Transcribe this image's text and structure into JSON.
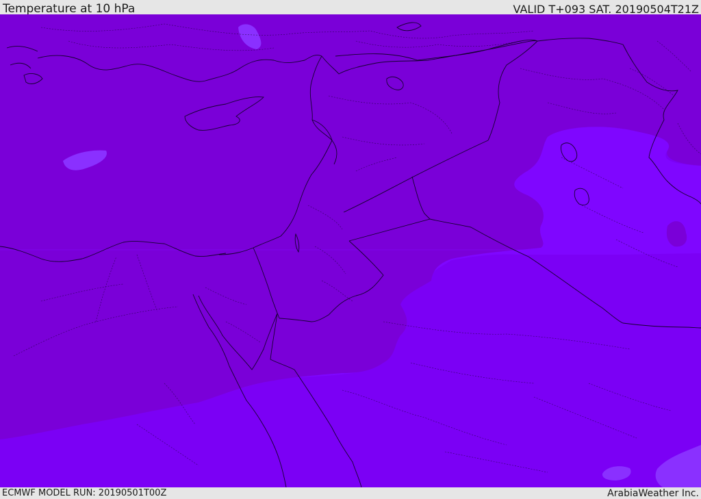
{
  "header": {
    "title": "Temperature at 10 hPa",
    "valid": "VALID T+093 SAT. 20190504T21Z"
  },
  "footer": {
    "model_run": "ECMWF MODEL RUN: 20190501T00Z",
    "credit": "ArabiaWeather Inc."
  },
  "map": {
    "fill_colors": {
      "dark_band": "#7a00d8",
      "mid_band": "#7b00f5",
      "light_band": "#7f06ff",
      "pale_patch": "#8a30ff"
    },
    "line_colors": {
      "coastline": "#15002e",
      "border": "#15002e"
    }
  }
}
